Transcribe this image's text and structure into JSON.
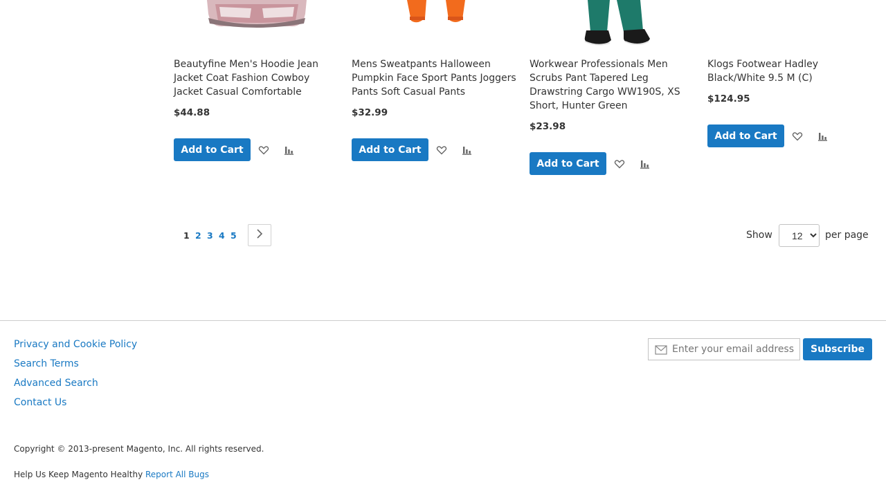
{
  "products": [
    {
      "name": "Beautyfine Men's Hoodie Jean Jacket Coat Fashion Cowboy Jacket Casual Comfortable",
      "price": "$44.88",
      "add_to_cart": "Add to Cart"
    },
    {
      "name": "Mens Sweatpants Halloween Pumpkin Face Sport Pants Joggers Pants Soft Casual Pants",
      "price": "$32.99",
      "add_to_cart": "Add to Cart"
    },
    {
      "name": "Workwear Professionals Men Scrubs Pant Tapered Leg Drawstring Cargo WW190S, XS Short, Hunter Green",
      "price": "$23.98",
      "add_to_cart": "Add to Cart"
    },
    {
      "name": "Klogs Footwear Hadley Black/White 9.5 M (C)",
      "price": "$124.95",
      "add_to_cart": "Add to Cart"
    }
  ],
  "pager": {
    "pages": [
      "1",
      "2",
      "3",
      "4",
      "5"
    ],
    "current": "1",
    "next_icon": "chevron-right-icon"
  },
  "limiter": {
    "show_label": "Show",
    "value": "12",
    "per_page_label": "per page"
  },
  "footer": {
    "links": [
      "Privacy and Cookie Policy",
      "Search Terms",
      "Advanced Search",
      "Contact Us"
    ],
    "newsletter_placeholder": "Enter your email address",
    "subscribe_label": "Subscribe",
    "copyright": "Copyright © 2013-present Magento, Inc. All rights reserved.",
    "help_text": "Help Us Keep Magento Healthy",
    "report_bugs": "Report All Bugs"
  },
  "colors": {
    "accent": "#1979c3",
    "text": "#333333",
    "border": "#cccccc"
  },
  "icons": {
    "wishlist": "heart-icon",
    "compare": "compare-icon",
    "email": "envelope-icon"
  }
}
